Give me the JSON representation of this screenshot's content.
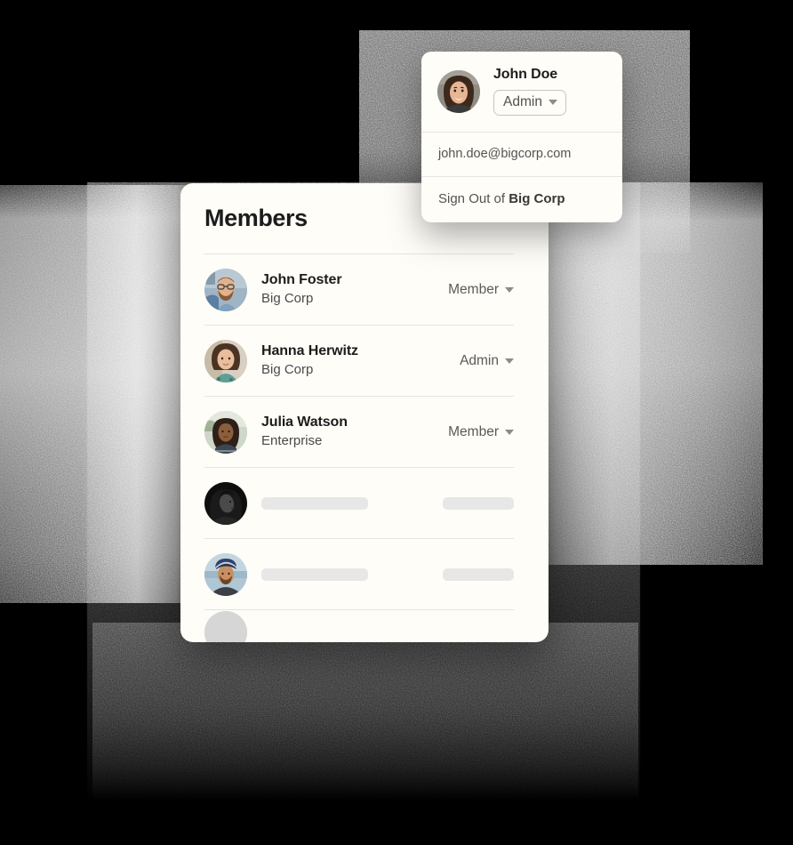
{
  "theme": {
    "page_background": "#000000",
    "card_background": "#FFFDF8",
    "text_primary": "#1C1C1C",
    "text_secondary": "#55534F",
    "divider": "#E6E4E0",
    "skeleton": "#E7E7E7"
  },
  "members_card": {
    "title": "Members",
    "rows": [
      {
        "name": "John Foster",
        "org": "Big Corp",
        "role": "Member",
        "avatar": "man-with-glasses-beard-avatar",
        "type": "member"
      },
      {
        "name": "Hanna Herwitz",
        "org": "Big Corp",
        "role": "Admin",
        "avatar": "woman-curly-hair-avatar",
        "type": "member"
      },
      {
        "name": "Julia Watson",
        "org": "Enterprise",
        "role": "Member",
        "avatar": "woman-outdoors-avatar",
        "type": "member"
      },
      {
        "name": "",
        "org": "",
        "role": "",
        "avatar": "person-dark-portrait-avatar",
        "type": "skeleton"
      },
      {
        "name": "",
        "org": "",
        "role": "",
        "avatar": "man-with-cap-beach-avatar",
        "type": "skeleton"
      },
      {
        "name": "",
        "org": "",
        "role": "",
        "avatar": "placeholder-avatar",
        "type": "skeleton-partial"
      }
    ]
  },
  "account_popover": {
    "name": "John Doe",
    "avatar": "man-smiling-avatar",
    "role_chip_label": "Admin",
    "email": "john.doe@bigcorp.com",
    "sign_out_prefix": "Sign Out of ",
    "sign_out_org": "Big Corp"
  },
  "icons": {
    "caret_down": "chevron-down-icon"
  }
}
